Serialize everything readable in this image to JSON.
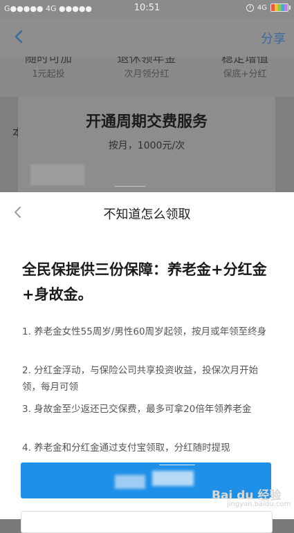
{
  "status_bar": {
    "carrier": "G●●●●● 4G ●●●●●",
    "time": "10:51",
    "network": "4G"
  },
  "nav": {
    "share_label": "分享"
  },
  "background": {
    "features": [
      {
        "title": "随时可加",
        "sub": "1元起投"
      },
      {
        "title": "退休领年金",
        "sub": "次月领分红"
      },
      {
        "title": "稳定增值",
        "sub": "保底+分红"
      }
    ],
    "partial_text": "本"
  },
  "dialog": {
    "title": "开通周期交费服务",
    "subtitle": "按月，1000元/次"
  },
  "sheet": {
    "title": "不知道怎么领取",
    "headline": "全民保提供三份保障：养老金+分红金+身故金。",
    "items": [
      "1. 养老金女性55周岁/男性60周岁起领，按月或年领至终身",
      "2. 分红金浮动，与保险公司共享投资收益，投保次月开始领，每月可领",
      "3. 身故金至少返还已交保费，最多可拿20倍年领养老金",
      "4. 养老金和分红金通过支付宝领取，分红随时提现"
    ]
  },
  "watermark": {
    "brand": "Bai du 经验",
    "url": "jingyan.baidu.com"
  },
  "colors": {
    "accent": "#1e90e8",
    "share": "#3c6a9c",
    "overlay": "#7a7a7a"
  }
}
